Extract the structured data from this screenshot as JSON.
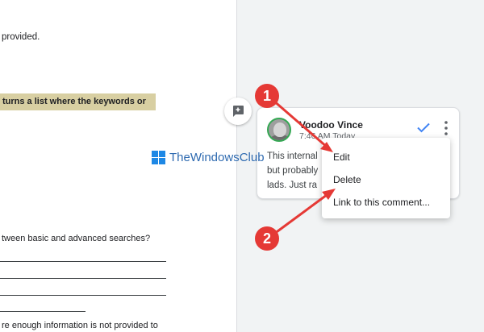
{
  "document": {
    "line1": "provided.",
    "highlight": "turns a list where the keywords or",
    "line2": "tween basic and advanced searches?",
    "line3": "re enough information is not provided to"
  },
  "add_comment_icon": "add-comment-icon",
  "comment": {
    "author": "Voodoo Vince",
    "meta": "7:46 AM Today",
    "text_lines": [
      "This internal",
      "but probably",
      "lads. Just ra"
    ],
    "resolve_icon": "checkmark-icon",
    "more_icon": "more-vert-icon"
  },
  "menu": {
    "items": [
      "Edit",
      "Delete",
      "Link to this comment..."
    ]
  },
  "watermark": {
    "text": "TheWindowsClub"
  },
  "annotations": {
    "badge1": "1",
    "badge2": "2"
  },
  "colors": {
    "annotation_red": "#e53935",
    "resolve_blue": "#4285f4",
    "highlight": "#d8cfa2",
    "avatar_ring": "#34a853"
  }
}
